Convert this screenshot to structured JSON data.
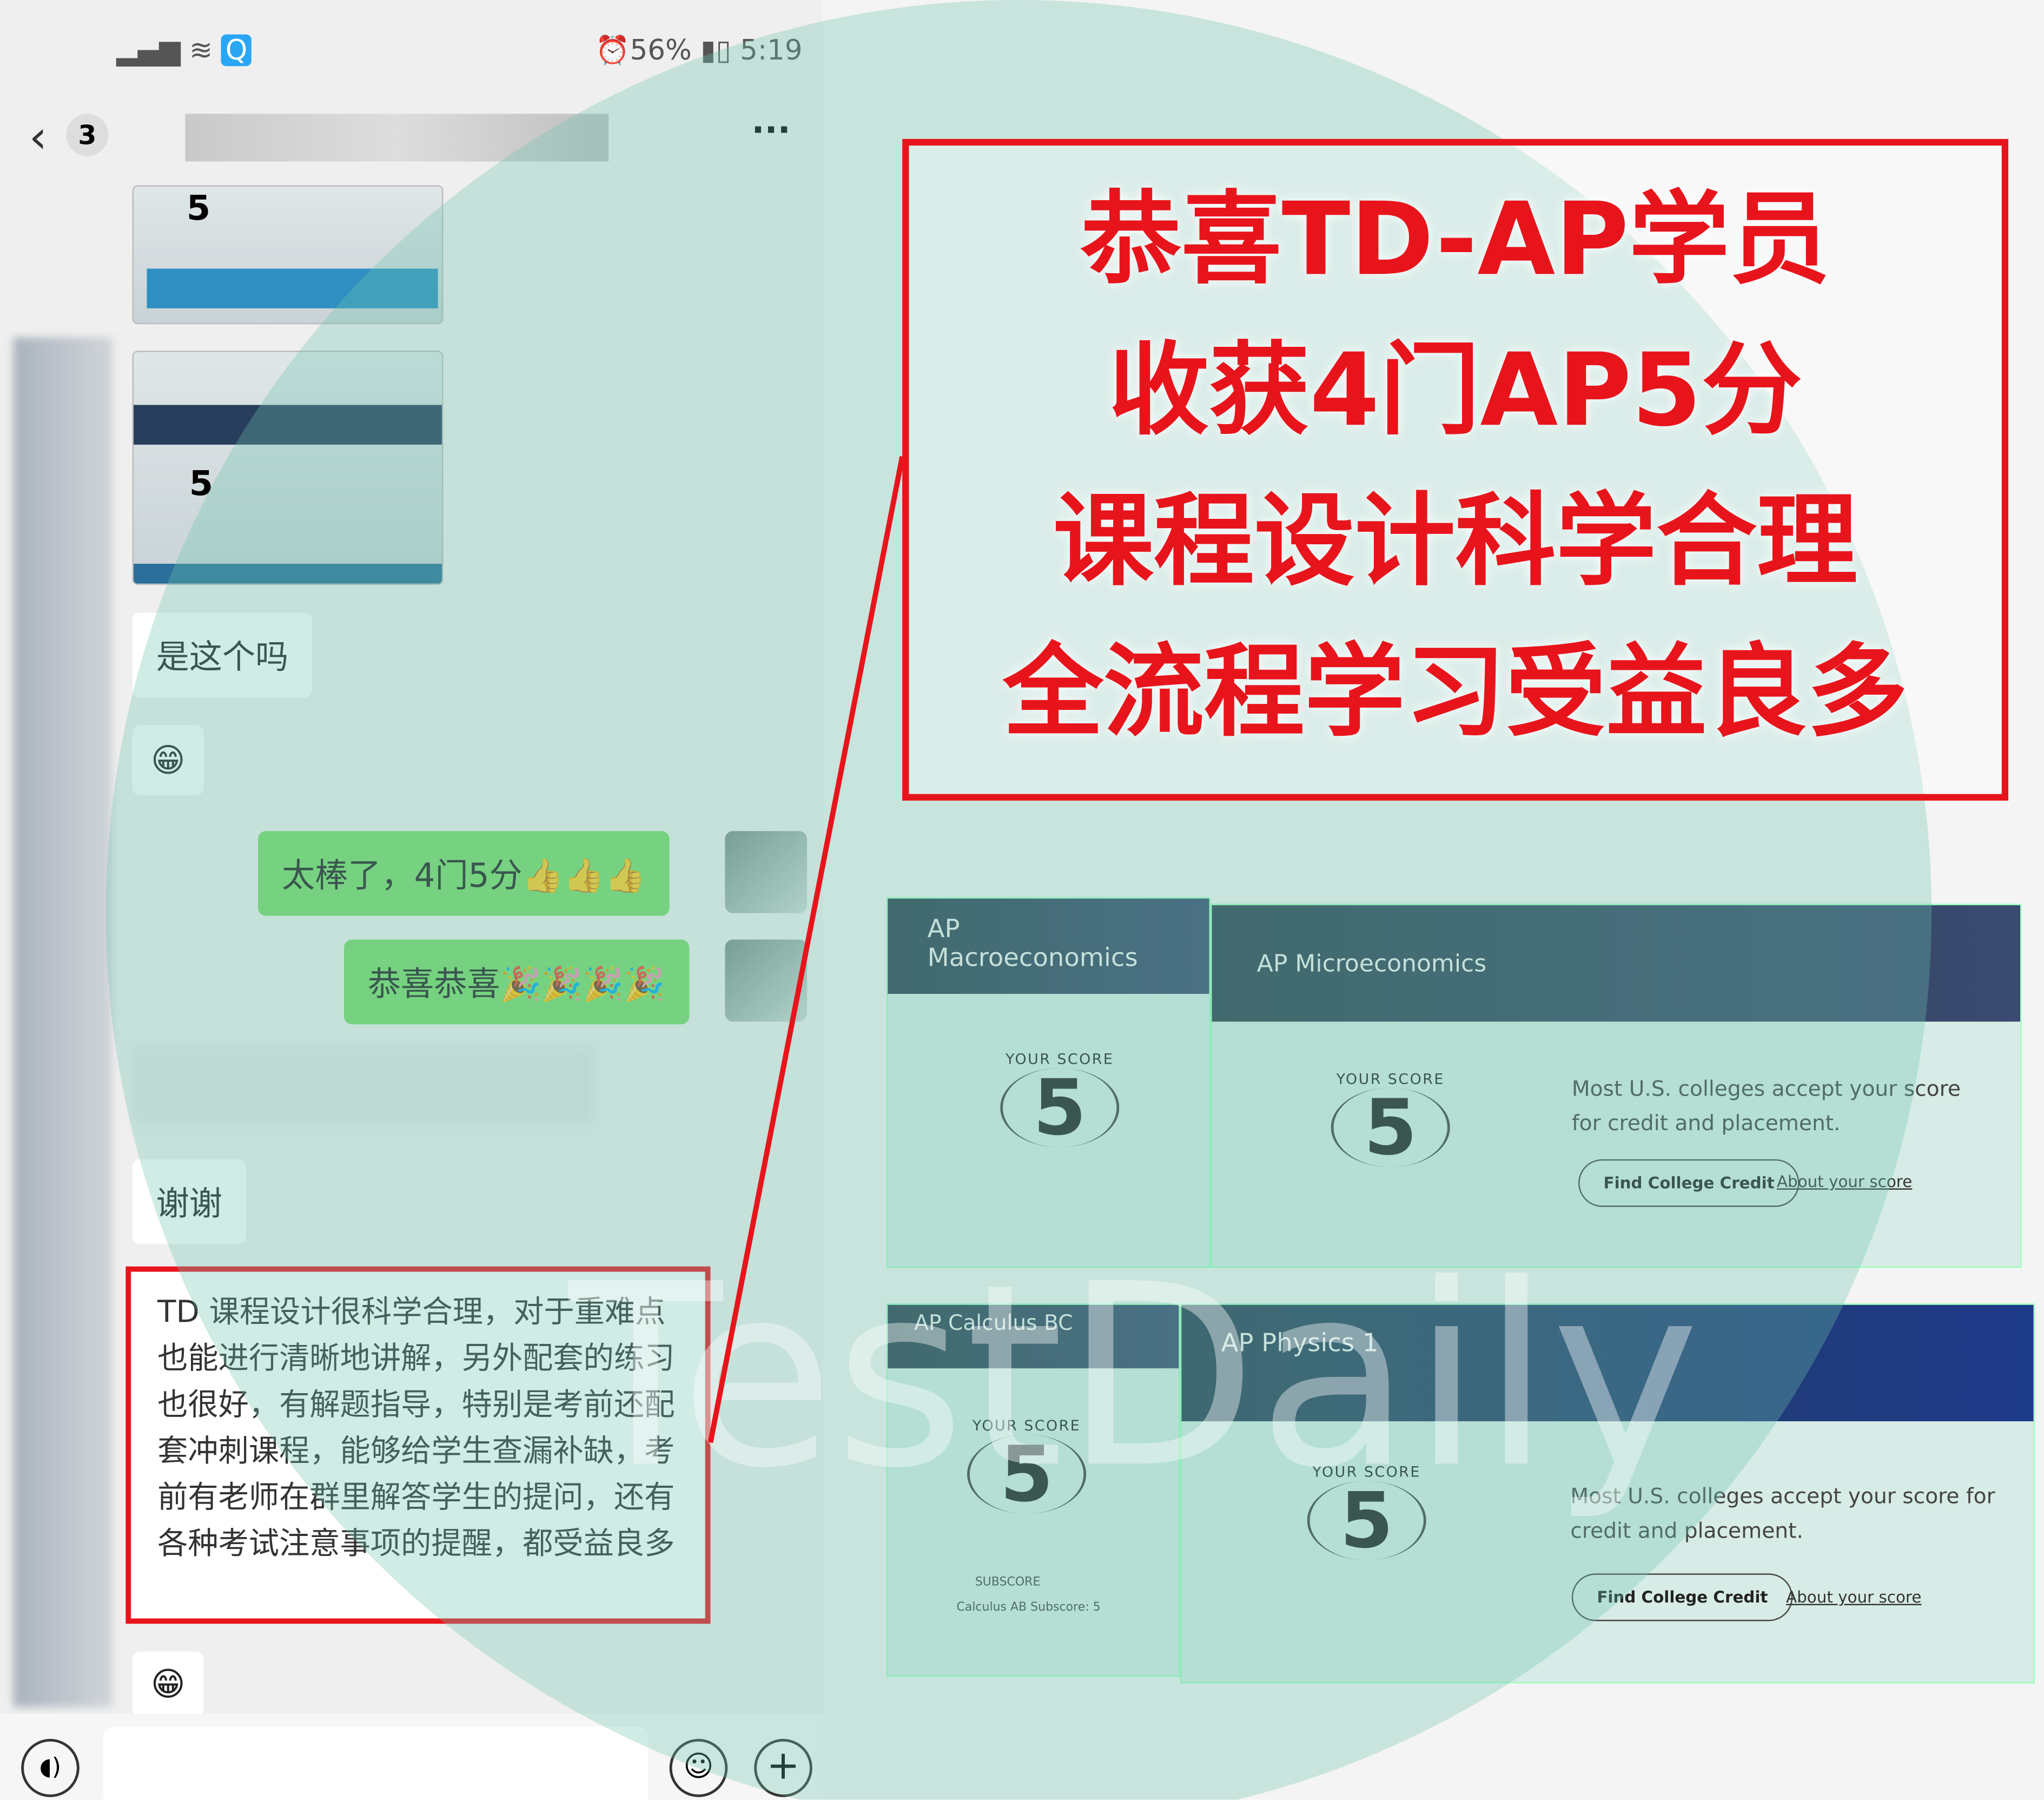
{
  "status_bar": {
    "signal": "4G",
    "battery_percent": "56%",
    "time": "5:19",
    "icons": [
      "signal-icon",
      "wifi-icon",
      "app-notification-icon",
      "alarm-icon",
      "battery-icon"
    ]
  },
  "chat_header": {
    "unread_count": "3",
    "title_blurred": true,
    "more_icon": "more-dots-icon"
  },
  "messages": [
    {
      "side": "left",
      "type": "image"
    },
    {
      "side": "left",
      "type": "image"
    },
    {
      "side": "left",
      "text": "是这个吗"
    },
    {
      "side": "left",
      "text": "😁"
    },
    {
      "side": "right",
      "text": "太棒了，4门5分👍👍👍"
    },
    {
      "side": "right",
      "text": "恭喜恭喜🎉🎉🎉🎉"
    },
    {
      "side": "left",
      "text": "谢谢"
    },
    {
      "side": "left",
      "text": "TD 课程设计很科学合理，对于重难点也能进行清晰地讲解，另外配套的练习也很好，有解题指导，特别是考前还配套冲刺课程，能够给学生查漏补缺，考前有老师在群里解答学生的提问，还有各种考试注意事项的提醒，都受益良多"
    },
    {
      "side": "left",
      "text": "😁"
    }
  ],
  "headline": {
    "lines": [
      "恭喜TD-AP学员",
      "收获4门AP5分",
      "课程设计科学合理",
      "全流程学习受益良多"
    ],
    "color": "#e8141c"
  },
  "score_cards": [
    {
      "subject": "AP Macroeconomics",
      "score_label": "YOUR SCORE",
      "score": "5"
    },
    {
      "subject": "AP Microeconomics",
      "score_label": "YOUR SCORE",
      "score": "5",
      "message": "Most U.S. colleges accept your score for credit and placement.",
      "button": "Find College Credit",
      "link": "About your score"
    },
    {
      "subject": "AP Calculus BC",
      "score_label": "YOUR SCORE",
      "score": "5",
      "subscore_label": "SUBSCORE",
      "subscore": "Calculus AB Subscore: 5"
    },
    {
      "subject": "AP Physics 1",
      "score_label": "YOUR SCORE",
      "score": "5",
      "message": "Most U.S. colleges accept your score for credit and placement.",
      "button": "Find College Credit",
      "link": "About your score"
    }
  ],
  "watermark": "TestDaily",
  "input_bar": {
    "icons": [
      "voice-icon",
      "emoji-icon",
      "plus-icon"
    ]
  }
}
